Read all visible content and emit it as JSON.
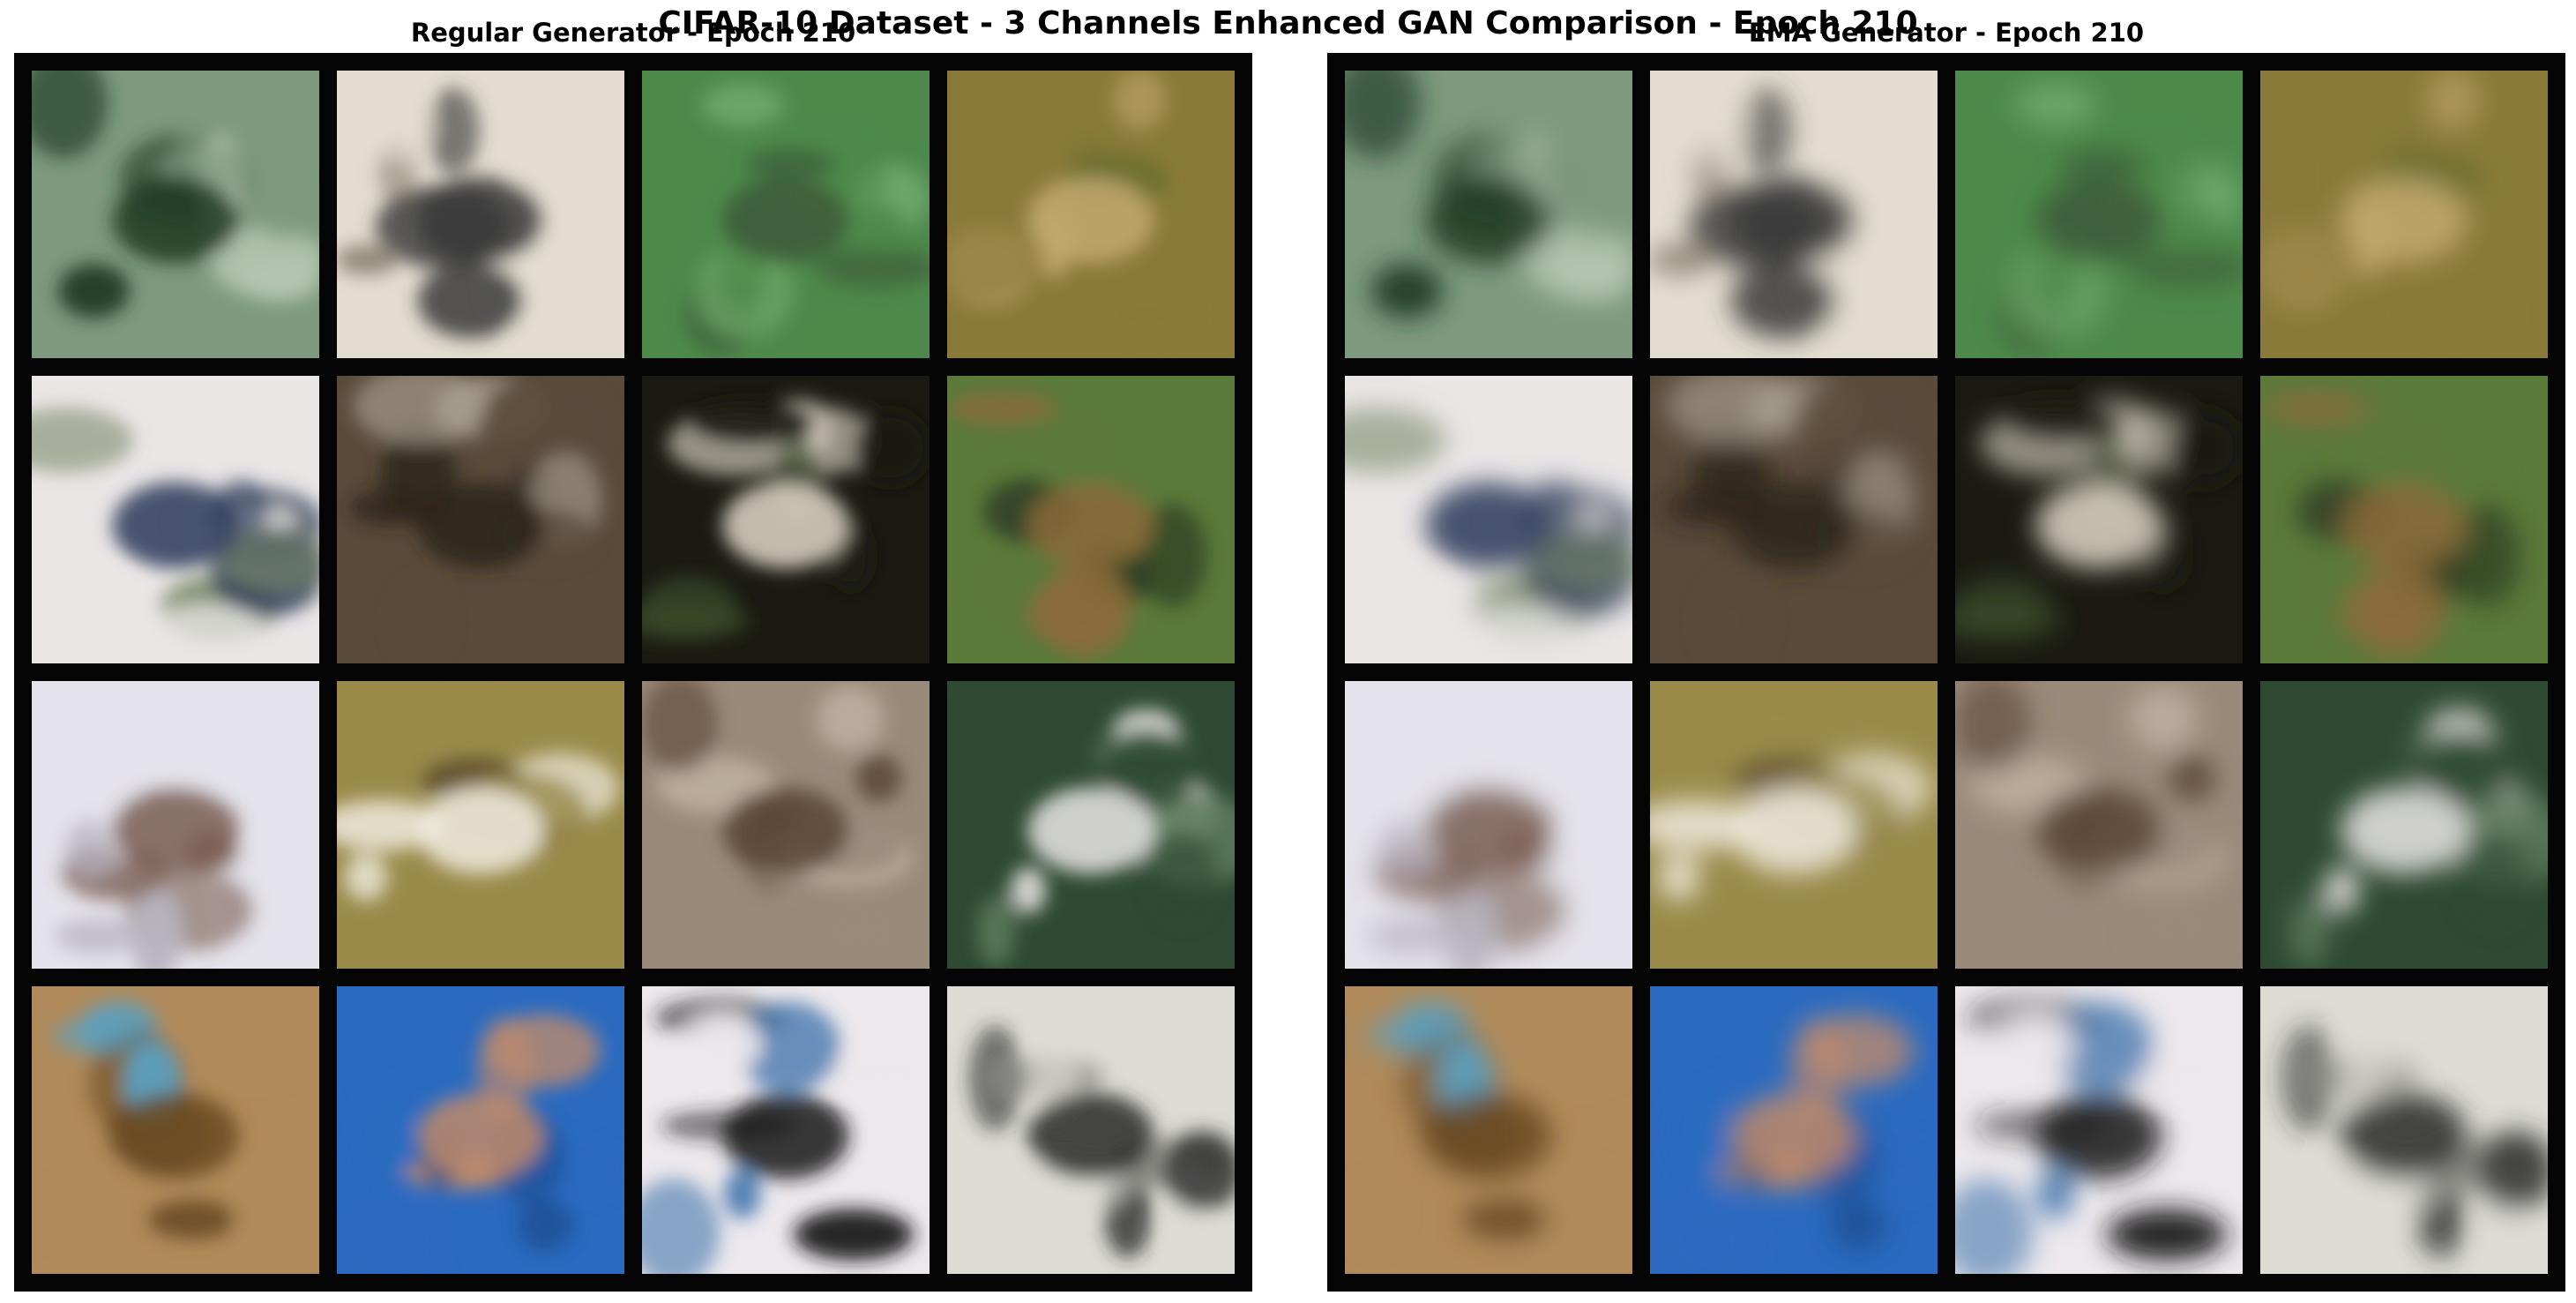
{
  "figure": {
    "title": "CIFAR-10 Dataset - 3 Channels Enhanced GAN Comparison - Epoch 210",
    "panels": [
      {
        "title": "Regular Generator - Epoch 210"
      },
      {
        "title": "EMA Generator - Epoch 210"
      }
    ],
    "grid": {
      "rows": 4,
      "cols": 4
    },
    "samples": [
      {
        "description": "bird on grass",
        "bg": "#7d9a7e",
        "accent": "#1f3a22",
        "tone": "#b5c7b0"
      },
      {
        "description": "bird on light background",
        "bg": "#e3ddd0",
        "accent": "#3a3a3a",
        "tone": "#8a8070"
      },
      {
        "description": "green field",
        "bg": "#4d8a4a",
        "accent": "#3d5a3a",
        "tone": "#6ea86a"
      },
      {
        "description": "deer in foliage",
        "bg": "#8a7a3a",
        "accent": "#c2a870",
        "tone": "#5a6a2a"
      },
      {
        "description": "car on street",
        "bg": "#eae6e6",
        "accent": "#2a3a5a",
        "tone": "#7a8a6a"
      },
      {
        "description": "cat face",
        "bg": "#5a4a3a",
        "accent": "#2a2418",
        "tone": "#a8a090"
      },
      {
        "description": "white horse",
        "bg": "#1a1a12",
        "accent": "#e0d8c8",
        "tone": "#3a4a2a"
      },
      {
        "description": "animal in grass",
        "bg": "#5a7a3a",
        "accent": "#8a6a3a",
        "tone": "#2e3e22"
      },
      {
        "description": "bird on white",
        "bg": "#e4e2ea",
        "accent": "#7a5e52",
        "tone": "#b8b4c0"
      },
      {
        "description": "dog on sand",
        "bg": "#9a8a4a",
        "accent": "#f0ece0",
        "tone": "#5a4a2a"
      },
      {
        "description": "brown animal",
        "bg": "#9a8a7a",
        "accent": "#5a4434",
        "tone": "#c2b4a4"
      },
      {
        "description": "horse by trees",
        "bg": "#2e4a32",
        "accent": "#eae6e6",
        "tone": "#5a7a5a"
      },
      {
        "description": "frog",
        "bg": "#b08a5a",
        "accent": "#6a4a22",
        "tone": "#5aa0c0"
      },
      {
        "description": "bird on blue sky",
        "bg": "#2a6ac0",
        "accent": "#c08a6a",
        "tone": "#1a4a8a"
      },
      {
        "description": "white ship",
        "bg": "#ece8ec",
        "accent": "#1a1a1a",
        "tone": "#4a7ab0"
      },
      {
        "description": "airplane",
        "bg": "#dcdcd4",
        "accent": "#2a2a2a",
        "tone": "#8a8a84"
      }
    ]
  }
}
